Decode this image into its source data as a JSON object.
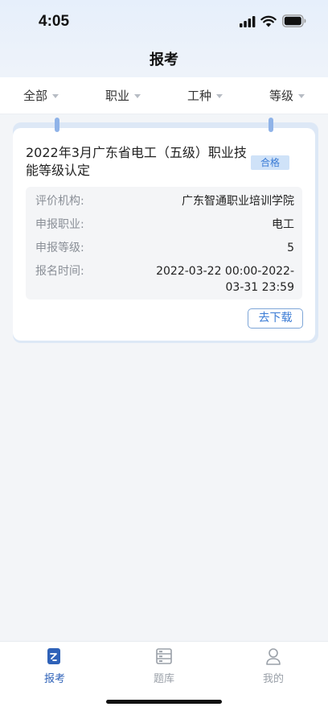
{
  "status_bar": {
    "time": "4:05"
  },
  "header": {
    "title": "报考"
  },
  "filters": [
    {
      "label": "全部"
    },
    {
      "label": "职业"
    },
    {
      "label": "工种"
    },
    {
      "label": "等级"
    }
  ],
  "card": {
    "title": "2022年3月广东省电工（五级）职业技能等级认定",
    "status_badge": "合格",
    "rows": [
      {
        "label": "评价机构:",
        "value": "广东智通职业培训学院"
      },
      {
        "label": "申报职业:",
        "value": "电工"
      },
      {
        "label": "申报等级:",
        "value": "5"
      },
      {
        "label": "报名时间:",
        "value": "2022-03-22 00:00-2022-03-31 23:59"
      }
    ],
    "download_label": "去下载"
  },
  "tab_bar": {
    "tabs": [
      {
        "label": "报考",
        "icon": "exam-icon",
        "active": true
      },
      {
        "label": "题库",
        "icon": "question-bank-icon",
        "active": false
      },
      {
        "label": "我的",
        "icon": "profile-icon",
        "active": false
      }
    ]
  },
  "colors": {
    "accent": "#2f62b8",
    "badge_bg": "#cfe2f8",
    "badge_text": "#3a7bd5"
  }
}
